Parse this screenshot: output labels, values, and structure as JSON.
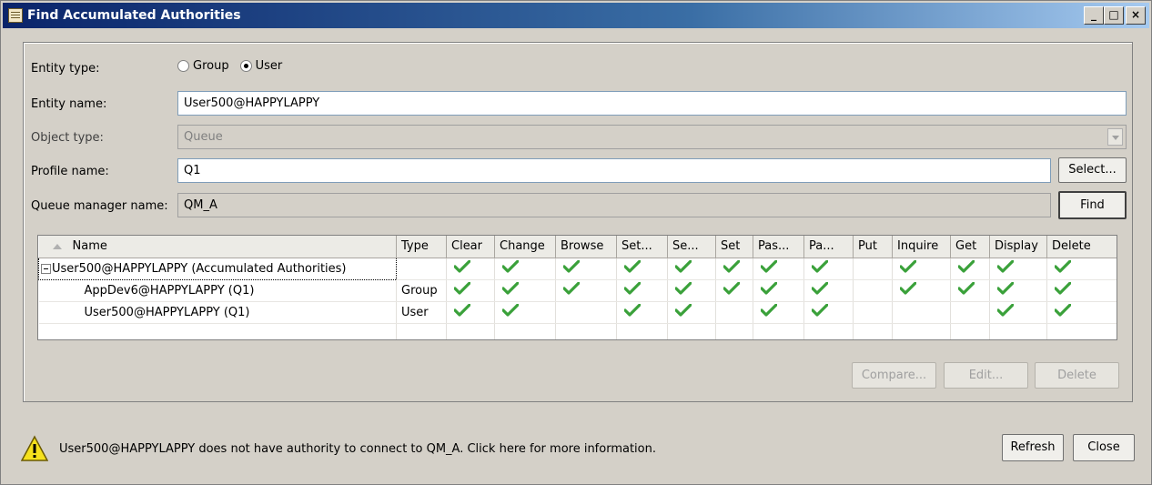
{
  "window": {
    "title": "Find Accumulated Authorities",
    "min": "_",
    "max": "□",
    "close": "×"
  },
  "form": {
    "entity_type_label": "Entity type:",
    "entity_type_options": [
      "Group",
      "User"
    ],
    "entity_type_selected": "User",
    "entity_name_label": "Entity name:",
    "entity_name_value": "User500@HAPPYLAPPY",
    "object_type_label": "Object type:",
    "object_type_value": "Queue",
    "profile_name_label": "Profile name:",
    "profile_name_value": "Q1",
    "select_button": "Select...",
    "qmgr_label": "Queue manager name:",
    "qmgr_value": "QM_A",
    "find_button": "Find"
  },
  "table": {
    "columns": [
      "Name",
      "Type",
      "Clear",
      "Change",
      "Browse",
      "Set...",
      "Se...",
      "Set",
      "Pas...",
      "Pa...",
      "Put",
      "Inquire",
      "Get",
      "Display",
      "Delete"
    ],
    "rows": [
      {
        "name": "User500@HAPPYLAPPY (Accumulated Authorities)",
        "type": "",
        "checks": [
          true,
          true,
          true,
          true,
          true,
          true,
          true,
          true,
          false,
          true,
          true,
          true,
          true
        ],
        "expanded": true
      },
      {
        "name": "AppDev6@HAPPYLAPPY (Q1)",
        "type": "Group",
        "checks": [
          true,
          true,
          true,
          true,
          true,
          true,
          true,
          true,
          false,
          true,
          true,
          true,
          true
        ]
      },
      {
        "name": "User500@HAPPYLAPPY (Q1)",
        "type": "User",
        "checks": [
          true,
          true,
          false,
          true,
          true,
          false,
          true,
          true,
          false,
          false,
          false,
          true,
          true
        ]
      }
    ]
  },
  "actions": {
    "compare": "Compare...",
    "edit": "Edit...",
    "delete": "Delete"
  },
  "status": {
    "message": "User500@HAPPYLAPPY does not have authority to connect to QM_A. Click here for more information.",
    "icon": "warning-icon"
  },
  "footer": {
    "refresh": "Refresh",
    "close": "Close"
  },
  "colors": {
    "check": "#3aa13a",
    "title_start": "#0a246a",
    "title_end": "#a6caf0"
  }
}
